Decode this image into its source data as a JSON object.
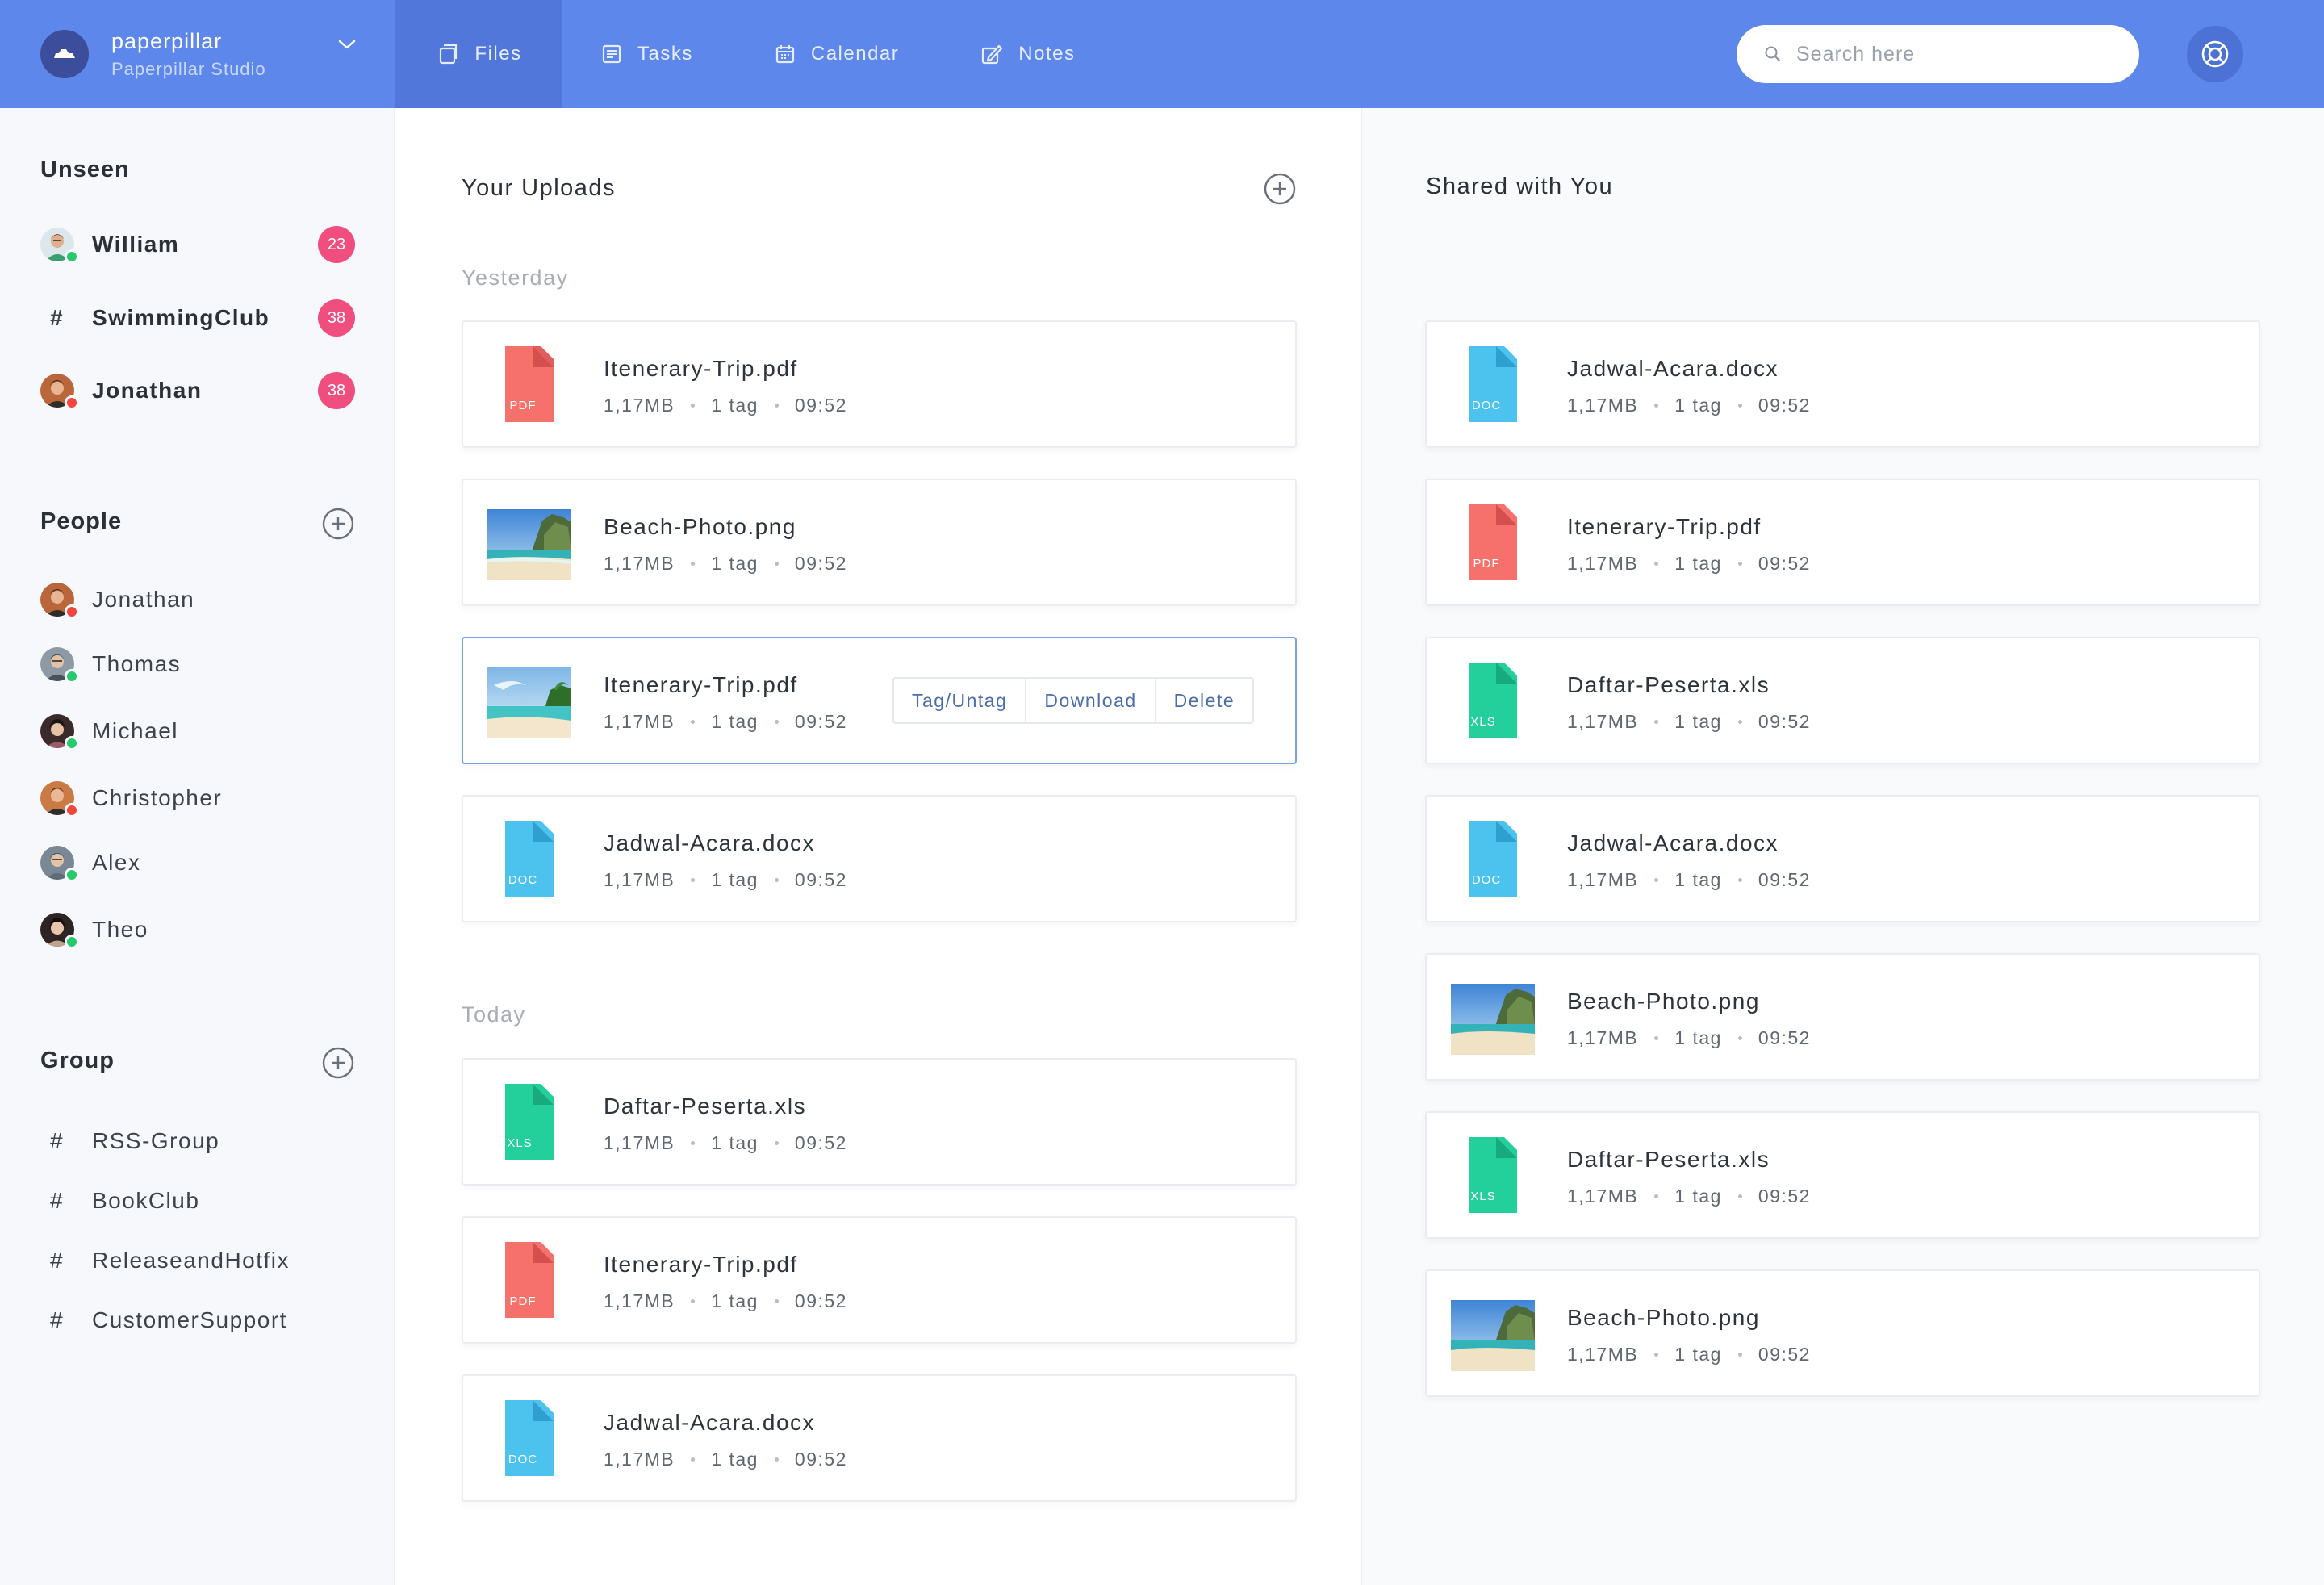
{
  "header": {
    "brand_name": "paperpillar",
    "brand_sub": "Paperpillar Studio",
    "tabs": [
      {
        "label": "Files",
        "icon": "files-icon",
        "active": true
      },
      {
        "label": "Tasks",
        "icon": "tasks-icon",
        "active": false
      },
      {
        "label": "Calendar",
        "icon": "calendar-icon",
        "active": false
      },
      {
        "label": "Notes",
        "icon": "notes-icon",
        "active": false
      }
    ],
    "search_placeholder": "Search here"
  },
  "sidebar": {
    "unseen_title": "Unseen",
    "unseen": [
      {
        "name": "William",
        "type": "person",
        "badge": "23",
        "status": "online"
      },
      {
        "name": "SwimmingClub",
        "type": "channel",
        "badge": "38"
      },
      {
        "name": "Jonathan",
        "type": "person",
        "badge": "38",
        "status": "busy"
      }
    ],
    "people_title": "People",
    "people": [
      {
        "name": "Jonathan",
        "status": "busy"
      },
      {
        "name": "Thomas",
        "status": "online"
      },
      {
        "name": "Michael",
        "status": "online"
      },
      {
        "name": "Christopher",
        "status": "busy"
      },
      {
        "name": "Alex",
        "status": "online"
      },
      {
        "name": "Theo",
        "status": "online"
      }
    ],
    "group_title": "Group",
    "groups": [
      "RSS-Group",
      "BookClub",
      "ReleaseandHotfix",
      "CustomerSupport"
    ]
  },
  "uploads": {
    "title": "Your Uploads",
    "yesterday_label": "Yesterday",
    "today_label": "Today",
    "yesterday": [
      {
        "name": "Itenerary-Trip.pdf",
        "type": "PDF",
        "size": "1,17MB",
        "tags": "1 tag",
        "time": "09:52"
      },
      {
        "name": "Beach-Photo.png",
        "type": "IMG",
        "size": "1,17MB",
        "tags": "1 tag",
        "time": "09:52"
      },
      {
        "name": "Itenerary-Trip.pdf",
        "type": "IMG2",
        "size": "1,17MB",
        "tags": "1 tag",
        "time": "09:52",
        "selected": true
      },
      {
        "name": "Jadwal-Acara.docx",
        "type": "DOC",
        "size": "1,17MB",
        "tags": "1 tag",
        "time": "09:52"
      }
    ],
    "today": [
      {
        "name": "Daftar-Peserta.xls",
        "type": "XLS",
        "size": "1,17MB",
        "tags": "1 tag",
        "time": "09:52"
      },
      {
        "name": "Itenerary-Trip.pdf",
        "type": "PDF",
        "size": "1,17MB",
        "tags": "1 tag",
        "time": "09:52"
      },
      {
        "name": "Jadwal-Acara.docx",
        "type": "DOC",
        "size": "1,17MB",
        "tags": "1 tag",
        "time": "09:52"
      }
    ],
    "actions": [
      "Tag/Untag",
      "Download",
      "Delete"
    ]
  },
  "shared": {
    "title": "Shared with You",
    "files": [
      {
        "name": "Jadwal-Acara.docx",
        "type": "DOC",
        "size": "1,17MB",
        "tags": "1 tag",
        "time": "09:52"
      },
      {
        "name": "Itenerary-Trip.pdf",
        "type": "PDF",
        "size": "1,17MB",
        "tags": "1 tag",
        "time": "09:52"
      },
      {
        "name": "Daftar-Peserta.xls",
        "type": "XLS",
        "size": "1,17MB",
        "tags": "1 tag",
        "time": "09:52"
      },
      {
        "name": "Jadwal-Acara.docx",
        "type": "DOC",
        "size": "1,17MB",
        "tags": "1 tag",
        "time": "09:52"
      },
      {
        "name": "Beach-Photo.png",
        "type": "IMG",
        "size": "1,17MB",
        "tags": "1 tag",
        "time": "09:52"
      },
      {
        "name": "Daftar-Peserta.xls",
        "type": "XLS",
        "size": "1,17MB",
        "tags": "1 tag",
        "time": "09:52"
      },
      {
        "name": "Beach-Photo.png",
        "type": "IMG",
        "size": "1,17MB",
        "tags": "1 tag",
        "time": "09:52"
      }
    ]
  },
  "colors": {
    "header": "#5d87ea",
    "pdf": "#f7716c",
    "doc": "#4cc2ee",
    "xls": "#23cf9b",
    "badge": "#f04e7f",
    "online": "#27c96b",
    "busy": "#f2453d"
  }
}
